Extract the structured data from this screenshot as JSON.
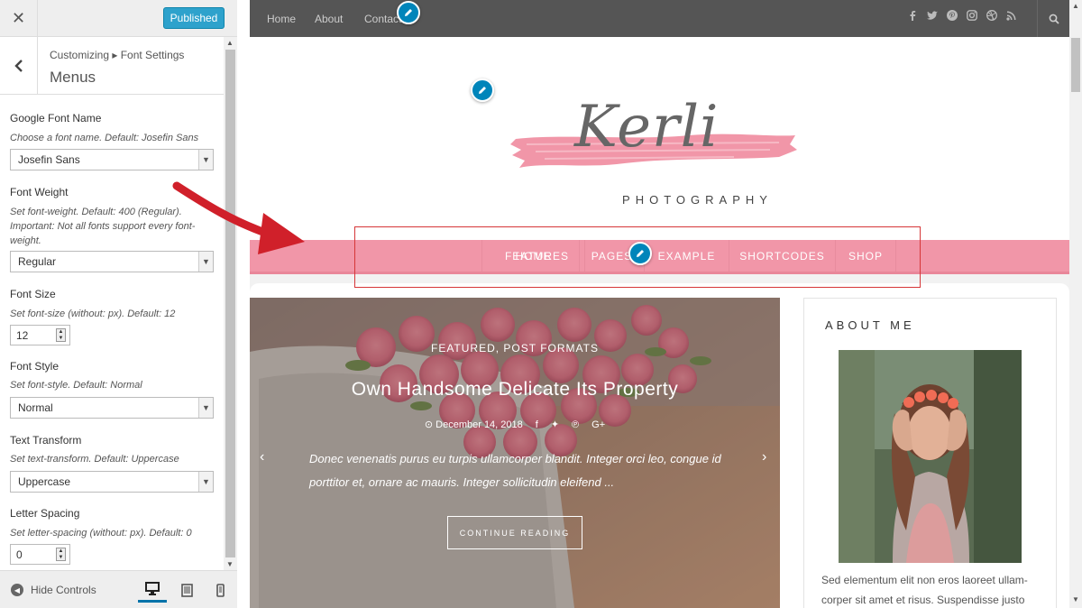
{
  "customizer": {
    "published_label": "Published",
    "breadcrumb": "Customizing ▸ Font Settings",
    "section_title": "Menus",
    "controls": {
      "font_name": {
        "label": "Google Font Name",
        "desc": "Choose a font name. Default: Josefin Sans",
        "value": "Josefin Sans"
      },
      "font_weight": {
        "label": "Font Weight",
        "desc": "Set font-weight. Default: 400 (Regular). Important: Not all fonts support every font-weight.",
        "value": "Regular"
      },
      "font_size": {
        "label": "Font Size",
        "desc": "Set font-size (without: px). Default: 12",
        "value": "12"
      },
      "font_style": {
        "label": "Font Style",
        "desc": "Set font-style. Default: Normal",
        "value": "Normal"
      },
      "text_transform": {
        "label": "Text Transform",
        "desc": "Set text-transform. Default: Uppercase",
        "value": "Uppercase"
      },
      "letter_spacing": {
        "label": "Letter Spacing",
        "desc": "Set letter-spacing (without: px). Default: 0",
        "value": "0"
      }
    },
    "footer": {
      "hide_controls": "Hide Controls"
    }
  },
  "site": {
    "top_nav": [
      "Home",
      "About",
      "Contact"
    ],
    "logo": {
      "name": "Kerli",
      "tagline": "PHOTOGRAPHY",
      "swash_color": "#f196a8"
    },
    "main_nav": [
      "HOME",
      "FEATURES",
      "PAGES",
      "EXAMPLE",
      "SHORTCODES",
      "SHOP"
    ],
    "slide": {
      "categories": "FEATURED, POST FORMATS",
      "title": "Own Handsome Delicate Its Property",
      "date": "December 14, 2018",
      "excerpt": "Donec venenatis purus eu turpis ullamcorper blandit. Integer orci leo, congue id porttitor et, ornare ac mauris. Integer sollicitudin eleifend  ...",
      "button": "CONTINUE READING",
      "prev": "‹",
      "next": "›"
    },
    "about": {
      "title": "ABOUT ME",
      "text": "Sed elementum elit non eros laoreet ullam-corper sit amet et risus. Suspendisse justo"
    }
  },
  "colors": {
    "accent": "#f196a8",
    "wp_blue": "#0085ba",
    "highlight": "#d63638",
    "arrow": "#d0202a"
  }
}
